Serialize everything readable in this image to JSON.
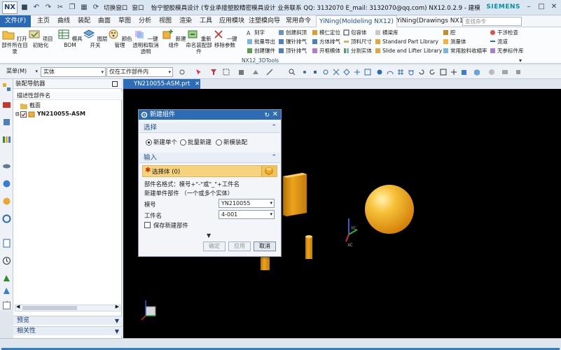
{
  "titlebar": {
    "app_logo": "NX",
    "switch_window": "切换窗口",
    "window_menu": "窗口",
    "title": "怡宁塑胶模具设计 (专业承接塑胶精密模具设计 业务联系 QQ: 3132070    E_mail: 3132070@qq.com)   NX12.0.2.9 - 建模",
    "brand": "SIEMENS"
  },
  "tabs": {
    "file": "文件(F)",
    "items": [
      "主页",
      "曲线",
      "装配",
      "曲面",
      "草图",
      "分析",
      "视图",
      "渲染",
      "工具",
      "应用模块",
      "注塑模向导",
      "常用命令",
      "YiNing(Moldeling NX12)",
      "YiNing(Drawings NX12)"
    ],
    "search_placeholder": "查找命令"
  },
  "ribbon": {
    "big_buttons": [
      "打开部件所在目录",
      "项目初始化",
      "模具BOM",
      "图层开关",
      "颜色管理",
      "一键透明和取消透明",
      "新建组件",
      "重新命名装配部件",
      "一键移除参数"
    ],
    "small_col1": [
      "刻字",
      "批量导出",
      "创建镶件"
    ],
    "small_col2": [
      "创建斜顶",
      "镶针排气",
      "顶针排气"
    ],
    "small_col3": [
      "模仁定位",
      "方体排气",
      "开框模体"
    ],
    "small_col4": [
      "包容体",
      "顶料尺寸",
      "分割实体"
    ],
    "small_col5": [
      "横梁库",
      "Standard Part Library",
      "Slide and Lifter Library"
    ],
    "small_col6": [
      "腔",
      "测量体",
      "常用胶料收缩率"
    ],
    "small_col7": [
      "干涉检查",
      "流道",
      "无参标件库"
    ],
    "group_label": "NX12_3DTools"
  },
  "toolbar": {
    "menu_label": "菜单(M)",
    "filter_value": "实体",
    "scope_value": "仅在工作部件内"
  },
  "navigator": {
    "title": "装配导航器",
    "column_header": "描述性部件名",
    "tree": [
      "截面",
      "YN210055-ASM"
    ],
    "sections": [
      "预览",
      "相关性"
    ]
  },
  "document_tab": "YN210055-ASM.prt",
  "dialog": {
    "title": "新建组件",
    "section_select": "选择",
    "radio_options": [
      "新建单个",
      "批量新建",
      "新模装配"
    ],
    "selected_radio": "新建单个",
    "section_input": "输入",
    "select_body": "选择体 (0)",
    "format_hint": "部件名格式：模号+\"-\"或\"_\"+工件名",
    "single_hint": "新建单件部件 （一个或多个实体）",
    "mold_no_label": "模号",
    "mold_no_value": "YN210055",
    "part_name_label": "工件名",
    "part_name_value": "4-001",
    "save_new_label": "保存新建部件",
    "buttons": [
      "确定",
      "应用",
      "取消"
    ]
  },
  "colors": {
    "accent_blue": "#2d6cb3",
    "selection_yellow": "#f6d37f",
    "body_orange": "#f0a20c",
    "siemens_teal": "#0b8f9c"
  }
}
